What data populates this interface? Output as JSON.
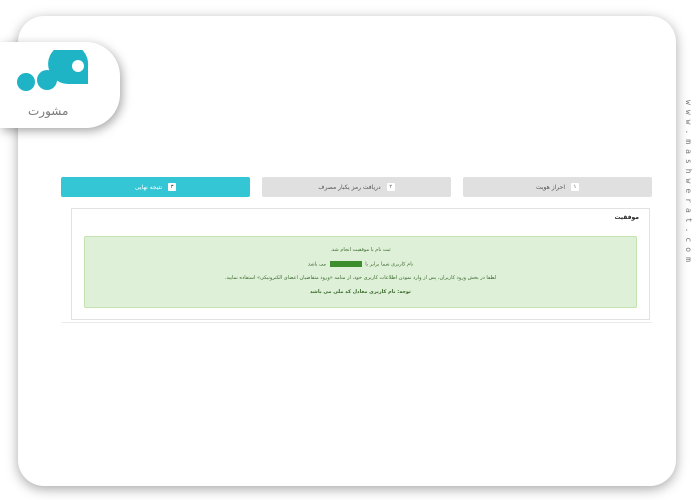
{
  "logo": {
    "text": "مشورت"
  },
  "watermark": "www.mashwerat.com",
  "steps": [
    {
      "number": "۱",
      "label": "احراز هویت",
      "active": false
    },
    {
      "number": "۲",
      "label": "دریافت رمز یکبار مصرف",
      "active": false
    },
    {
      "number": "۳",
      "label": "نتیجه نهایی",
      "active": true
    }
  ],
  "result": {
    "title": "موفقیت",
    "line1": "ثبت نام با موفقیت انجام شد.",
    "line2_before": "نام کاربری شما برابر با",
    "line2_after": "می باشد",
    "line3": "لطفا در بخش ورود کاربران، پس از وارد نمودن اطلاعات کاربری خود، از منامه «ورود متقاضیان اعضای الکترونیکی» استفاده نمایید.",
    "line4": "توجه: نام کاربری معادل کد ملی می باشد"
  },
  "colors": {
    "active_step": "#35c6d6",
    "inactive_step": "#e0e0e0",
    "success_bg": "#dff0d8",
    "success_text": "#3c6b2f"
  }
}
